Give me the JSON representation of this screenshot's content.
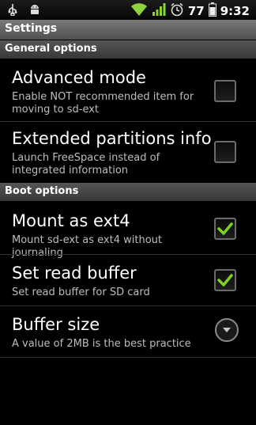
{
  "status_bar": {
    "battery_level": "77",
    "time": "9:32",
    "left_icons": [
      "usb-icon",
      "android-debug-icon"
    ],
    "right_icons": [
      "wifi-icon",
      "signal-icon",
      "alarm-icon",
      "battery-icon"
    ]
  },
  "title": "Settings",
  "sections": [
    {
      "header": "General options",
      "items": [
        {
          "title": "Advanced mode",
          "summary": "Enable NOT recommended item for moving to sd-ext",
          "checked": false
        },
        {
          "title": "Extended partitions info",
          "summary": "Launch FreeSpace instead of integrated information",
          "checked": false
        }
      ]
    },
    {
      "header": "Boot options",
      "items": [
        {
          "title": "Mount as ext4",
          "summary": "Mount sd-ext as ext4 without journaling",
          "checked": true
        },
        {
          "title": "Set read buffer",
          "summary": "Set read buffer for SD card",
          "checked": true
        },
        {
          "title": "Buffer size",
          "summary": "A value of 2MB is the best practice",
          "control": "dropdown"
        }
      ]
    }
  ],
  "colors": {
    "check_green": "#7ed321",
    "summary_text": "#bdbdbd",
    "header_bg": "#454545"
  }
}
